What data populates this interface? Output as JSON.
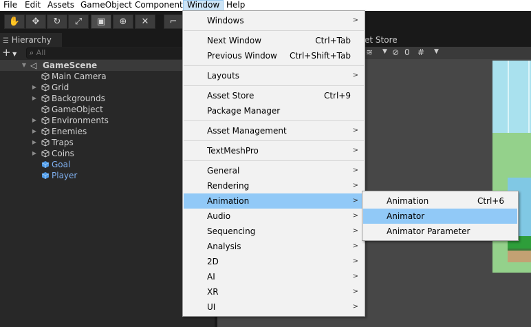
{
  "menubar": {
    "items": [
      {
        "label": "File"
      },
      {
        "label": "Edit"
      },
      {
        "label": "Assets"
      },
      {
        "label": "GameObject"
      },
      {
        "label": "Component"
      },
      {
        "label": "Window"
      },
      {
        "label": "Help"
      }
    ],
    "active": "Window"
  },
  "toolbar": {
    "tools": [
      "hand-tool",
      "move-tool",
      "rotate-tool",
      "scale-tool",
      "rect-tool",
      "transform-tool",
      "custom-tool",
      "pivot-toggle"
    ],
    "glyphs": [
      "✋",
      "✥",
      "↻",
      "⤢",
      "▣",
      "⊕",
      "✕",
      "⌐"
    ]
  },
  "hierarchy": {
    "tab_label": "Hierarchy",
    "add_symbol": "+",
    "search_placeholder": "All",
    "scene_name": "GameScene",
    "items": [
      {
        "label": "Main Camera",
        "foldout": false,
        "prefab": false
      },
      {
        "label": "Grid",
        "foldout": true,
        "prefab": false
      },
      {
        "label": "Backgrounds",
        "foldout": true,
        "prefab": false
      },
      {
        "label": "GameObject",
        "foldout": false,
        "prefab": false
      },
      {
        "label": "Environments",
        "foldout": true,
        "prefab": false
      },
      {
        "label": "Enemies",
        "foldout": true,
        "prefab": false
      },
      {
        "label": "Traps",
        "foldout": true,
        "prefab": false
      },
      {
        "label": "Coins",
        "foldout": true,
        "prefab": false
      },
      {
        "label": "Goal",
        "foldout": false,
        "prefab": true
      },
      {
        "label": "Player",
        "foldout": false,
        "prefab": true
      }
    ]
  },
  "scene": {
    "tab_label_fragment": "et Store",
    "toolbar_count": "0"
  },
  "window_menu": {
    "items": [
      {
        "label": "Windows",
        "shortcut": "",
        "submenu": true
      },
      {
        "separator": true
      },
      {
        "label": "Next Window",
        "shortcut": "Ctrl+Tab",
        "submenu": false
      },
      {
        "label": "Previous Window",
        "shortcut": "Ctrl+Shift+Tab",
        "submenu": false
      },
      {
        "separator": true
      },
      {
        "label": "Layouts",
        "shortcut": "",
        "submenu": true
      },
      {
        "separator": true
      },
      {
        "label": "Asset Store",
        "shortcut": "Ctrl+9",
        "submenu": false
      },
      {
        "label": "Package Manager",
        "shortcut": "",
        "submenu": false
      },
      {
        "separator": true
      },
      {
        "label": "Asset Management",
        "shortcut": "",
        "submenu": true
      },
      {
        "separator": true
      },
      {
        "label": "TextMeshPro",
        "shortcut": "",
        "submenu": true
      },
      {
        "separator": true
      },
      {
        "label": "General",
        "shortcut": "",
        "submenu": true
      },
      {
        "label": "Rendering",
        "shortcut": "",
        "submenu": true
      },
      {
        "label": "Animation",
        "shortcut": "",
        "submenu": true,
        "highlighted": true
      },
      {
        "label": "Audio",
        "shortcut": "",
        "submenu": true
      },
      {
        "label": "Sequencing",
        "shortcut": "",
        "submenu": true
      },
      {
        "label": "Analysis",
        "shortcut": "",
        "submenu": true
      },
      {
        "label": "2D",
        "shortcut": "",
        "submenu": true
      },
      {
        "label": "AI",
        "shortcut": "",
        "submenu": true
      },
      {
        "label": "XR",
        "shortcut": "",
        "submenu": true
      },
      {
        "label": "UI",
        "shortcut": "",
        "submenu": true
      }
    ]
  },
  "animation_submenu": {
    "items": [
      {
        "label": "Animation",
        "shortcut": "Ctrl+6",
        "highlighted": false
      },
      {
        "label": "Animator",
        "shortcut": "",
        "highlighted": true
      },
      {
        "label": "Animator Parameter",
        "shortcut": "",
        "highlighted": false
      }
    ]
  },
  "colors": {
    "menu_highlight": "#91c9f7",
    "editor_bg": "#282828",
    "prefab_text": "#7fb0f0"
  }
}
